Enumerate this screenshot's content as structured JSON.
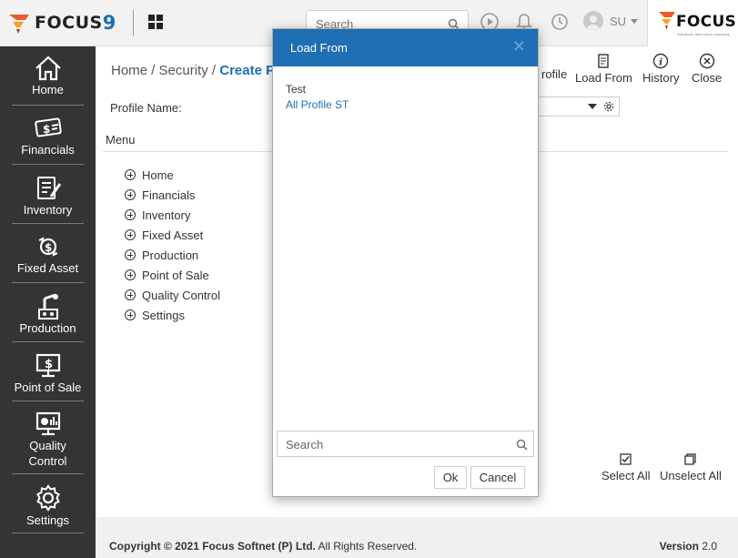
{
  "topbar": {
    "logo_word": "FOCUS",
    "logo_number": "9",
    "search_placeholder": "Search",
    "user_initials": "SU",
    "brand_word": "FOCUS",
    "brand_tagline": "Solutions that mean business"
  },
  "sidebar": {
    "items": [
      {
        "label": "Home",
        "icon": "home-icon"
      },
      {
        "label": "Financials",
        "icon": "money-icon"
      },
      {
        "label": "Inventory",
        "icon": "inventory-icon"
      },
      {
        "label": "Fixed Asset",
        "icon": "fixed-asset-icon"
      },
      {
        "label": "Production",
        "icon": "production-icon"
      },
      {
        "label": "Point of Sale",
        "icon": "pos-icon"
      },
      {
        "label": "Quality Control",
        "icon": "quality-icon"
      },
      {
        "label": "Settings",
        "icon": "gear-icon"
      }
    ]
  },
  "breadcrumb": {
    "home": "Home /",
    "security": "Security /",
    "current": "Create Pr"
  },
  "toolbar": {
    "profile": "rofile",
    "load_from": "Load From",
    "history": "History",
    "close": "Close"
  },
  "form": {
    "profile_name_label": "Profile Name:",
    "menu_label": "Menu"
  },
  "tree": {
    "items": [
      "Home",
      "Financials",
      "Inventory",
      "Fixed Asset",
      "Production",
      "Point of Sale",
      "Quality Control",
      "Settings"
    ]
  },
  "selection": {
    "select_all": "Select All",
    "unselect_all": "Unselect All"
  },
  "footer": {
    "copyright_prefix": "Copyright © 2021",
    "company": "Focus Softnet (P) Ltd.",
    "rights": "All Rights Reserved.",
    "version_label": "Version",
    "version_number": "2.0"
  },
  "modal": {
    "title": "Load From",
    "items": [
      "Test",
      "All Profile ST"
    ],
    "search_placeholder": "Search",
    "ok": "Ok",
    "cancel": "Cancel"
  },
  "colors": {
    "accent": "#1e6fb3",
    "sidebar_bg": "#343434",
    "brand_orange": "#f05a28"
  }
}
